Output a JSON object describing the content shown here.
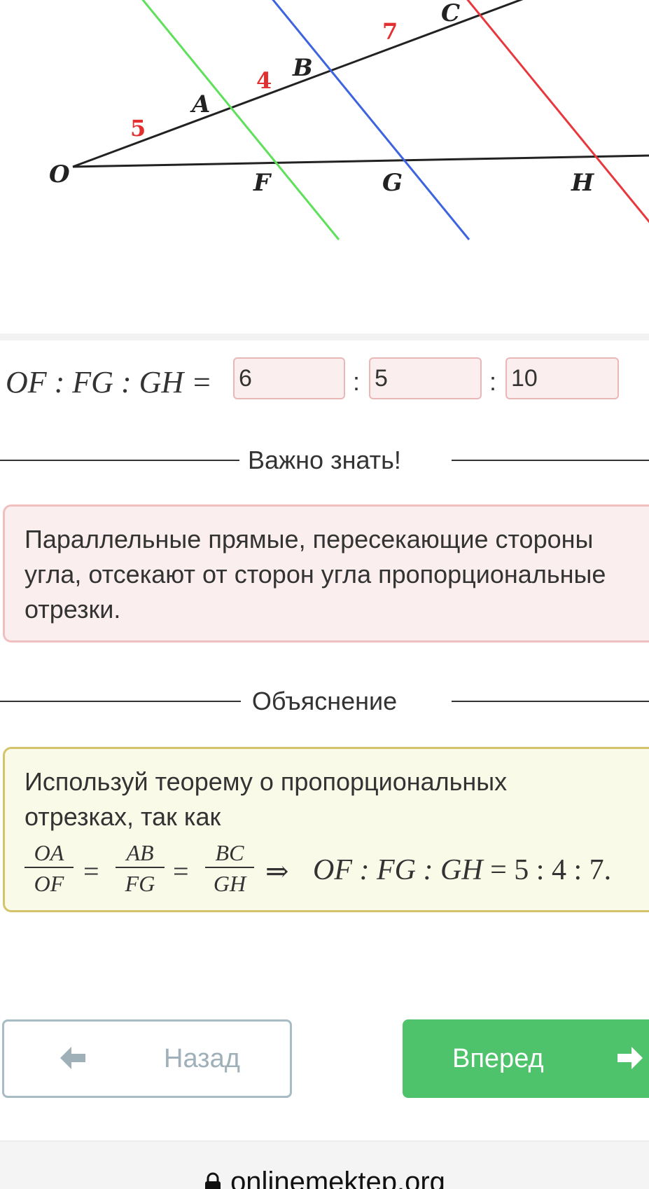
{
  "diagram": {
    "point_labels": [
      "O",
      "A",
      "B",
      "C",
      "F",
      "G",
      "H"
    ],
    "segment_labels": {
      "OA": "5",
      "AB": "4",
      "BC": "7"
    },
    "colors": {
      "ray": "#222222",
      "line_af": "#5ee05a",
      "line_bg": "#3d63e0",
      "line_ch": "#e8383d",
      "segment_label": "#e32f2f"
    }
  },
  "ratio": {
    "label": "OF : FG : GH =",
    "separator": ":",
    "answers": [
      "6",
      "5",
      "10"
    ]
  },
  "important": {
    "title": "Важно знать!",
    "lines": [
      "Параллельные прямые, пересекающие стороны",
      "угла, отсекают от сторон угла пропорциональные",
      "отрезки."
    ]
  },
  "explanation": {
    "title": "Объяснение",
    "lines": [
      "Используй теорему о пропорциональных",
      "отрезках, так как"
    ],
    "fractions": [
      {
        "num": "OA",
        "den": "OF"
      },
      {
        "num": "AB",
        "den": "FG"
      },
      {
        "num": "BC",
        "den": "GH"
      }
    ],
    "equals": "=",
    "implies": "⇒",
    "conclusion_lhs": "OF : FG : GH",
    "conclusion_rhs": "= 5 : 4 : 7."
  },
  "navigation": {
    "back_label": "Назад",
    "forward_label": "Вперед"
  },
  "footer": {
    "url": "onlinemektep.org"
  }
}
